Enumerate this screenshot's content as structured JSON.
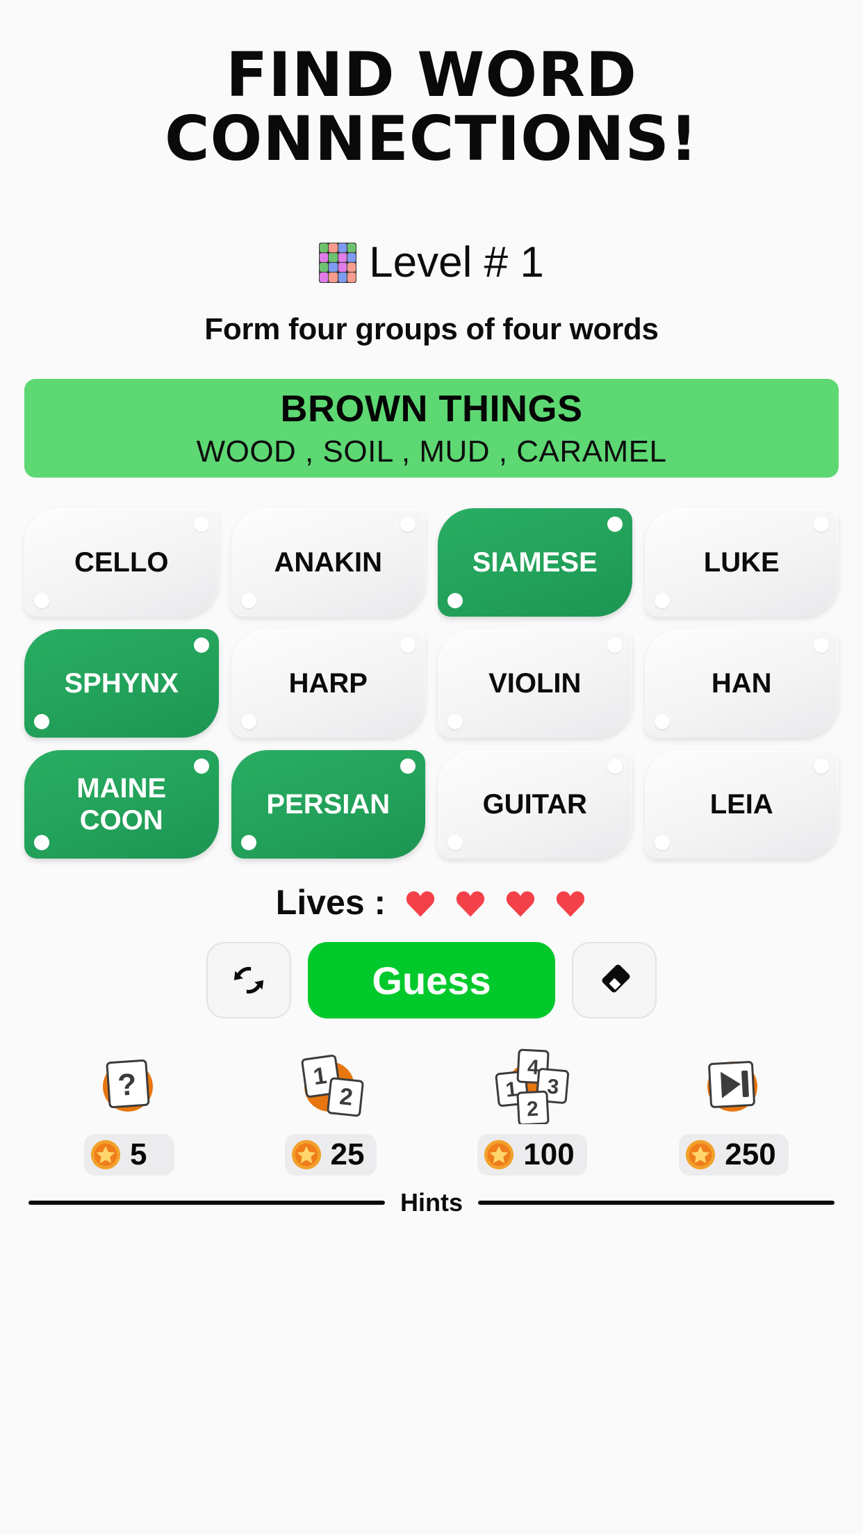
{
  "header": {
    "title_line1": "FIND WORD",
    "title_line2": "CONNECTIONS!",
    "level_label": "Level # 1",
    "level_icon": "puzzle-grid-icon",
    "subtitle": "Form four groups of four words"
  },
  "solved_group": {
    "category": "BROWN THINGS",
    "words": "WOOD , SOIL , MUD , CARAMEL",
    "color": "#5dd873"
  },
  "board": {
    "tiles": [
      {
        "label": "CELLO",
        "state": "idle"
      },
      {
        "label": "ANAKIN",
        "state": "idle"
      },
      {
        "label": "SIAMESE",
        "state": "selected"
      },
      {
        "label": "LUKE",
        "state": "idle"
      },
      {
        "label": "SPHYNX",
        "state": "selected"
      },
      {
        "label": "HARP",
        "state": "idle"
      },
      {
        "label": "VIOLIN",
        "state": "idle"
      },
      {
        "label": "HAN",
        "state": "idle"
      },
      {
        "label": "MAINE COON",
        "state": "selected"
      },
      {
        "label": "PERSIAN",
        "state": "selected"
      },
      {
        "label": "GUITAR",
        "state": "idle"
      },
      {
        "label": "LEIA",
        "state": "idle"
      }
    ],
    "selected_color": "#22a059",
    "idle_color": "#f4f4f5"
  },
  "lives": {
    "label": "Lives :",
    "count": 4,
    "heart_color": "#f44149"
  },
  "actions": {
    "shuffle_icon": "shuffle-icon",
    "guess_label": "Guess",
    "guess_color": "#02c92b",
    "erase_icon": "eraser-icon"
  },
  "hints": {
    "legend": "Hints",
    "items": [
      {
        "icon": "question-tile-icon",
        "cost": "5"
      },
      {
        "icon": "two-tiles-icon",
        "cost": "25"
      },
      {
        "icon": "four-tiles-icon",
        "cost": "100"
      },
      {
        "icon": "skip-level-icon",
        "cost": "250"
      }
    ],
    "coin_icon": "coin-star-icon"
  }
}
